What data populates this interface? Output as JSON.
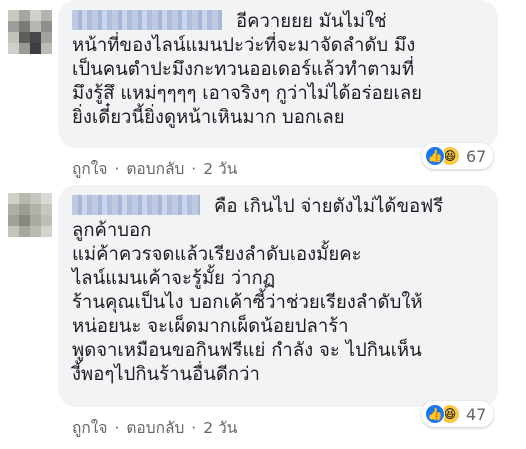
{
  "comments": [
    {
      "author": "",
      "text_lines": [
        "อีควายยย มันไม่ใช่",
        "หน้าที่ของไลน์แมนปะว่ะที่จะมาจัดลำดับ มึง",
        "เป็นคนตำปะมึงกะทวนออเดอร์แล้วทำตามที่",
        "มึงรู้สึ แหม่ๆๆๆๆ เอาจริงๆ กูว่าไม่ได้อร่อยเลย",
        "ยิ่งเดี๋ยวนี้ยิ่งดูหน้าเหินมาก บอกเลย"
      ],
      "reactions": {
        "icons": [
          "like-icon",
          "haha-icon"
        ],
        "count": "67"
      },
      "actions": {
        "like": "ถูกใจ",
        "reply": "ตอบกลับ",
        "time": "2 วัน",
        "dot": "·"
      }
    },
    {
      "author": "",
      "text_lines": [
        "คือ เกินไป จ่ายตังไม่ได้ขอฟรี",
        "ลูกค้าบอก",
        "แม่ค้าควรจดแล้วเรียงลำดับเองมั้ยคะ",
        "ไลน์แมนเค้าจะรู้มั้ย ว่ากฏ",
        "ร้านคุณเป็นไง บอกเค้าซี้ว่าช่วยเรียงลำดับให้",
        "หน่อยนะ จะเผ็ดมากเผ็ดน้อยปลาร้า",
        "พูดจาเหมือนขอกินฟรีแย่ กำลัง จะ ไปกินเห็น",
        "งี้พอๆไปกินร้านอื่นดีกว่า"
      ],
      "reactions": {
        "icons": [
          "like-icon",
          "haha-icon"
        ],
        "count": "47"
      },
      "actions": {
        "like": "ถูกใจ",
        "reply": "ตอบกลับ",
        "time": "2 วัน",
        "dot": "·"
      }
    }
  ],
  "colors": {
    "bubble": "#f2f3f5",
    "text": "#1c1e21",
    "meta": "#65676b",
    "like": "#1877f2",
    "haha": "#f7c945"
  }
}
